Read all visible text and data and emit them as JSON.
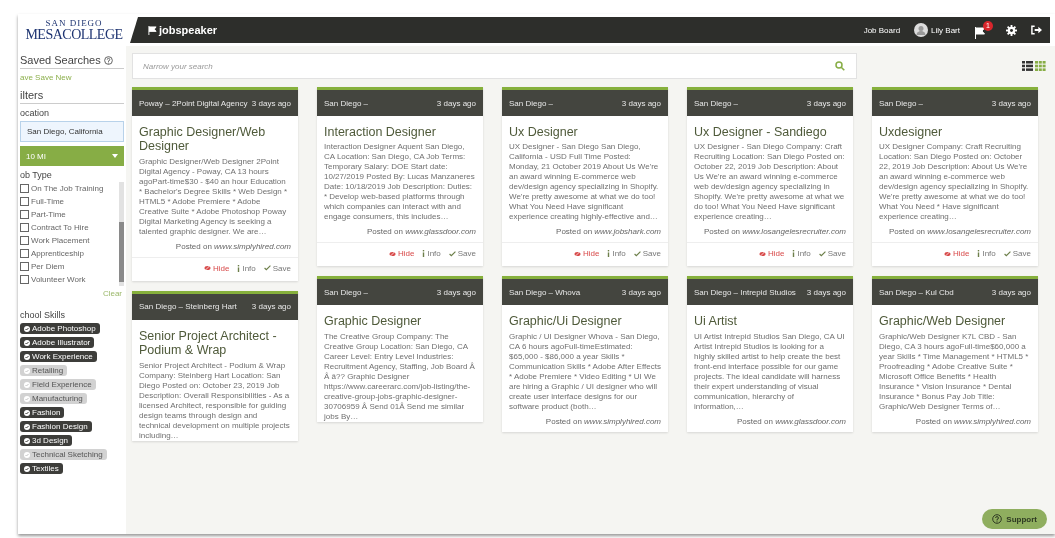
{
  "logo": {
    "line1": "SAN DIEGO",
    "line2": "MESACOLLEGE"
  },
  "header": {
    "brand": "jobspeaker",
    "nav": "Job Board",
    "user": "Lily Bart",
    "notification_count": "1"
  },
  "sidebar": {
    "saved_title": "Saved Searches",
    "saved_links": "ave Save New",
    "filters_title": "ilters",
    "location_label": "ocation",
    "location_value": "San Diego, California",
    "distance": "10 MI",
    "job_type_label": "ob Type",
    "job_types": [
      {
        "label": "On The Job Training",
        "checked": false
      },
      {
        "label": "Full-Time",
        "checked": false
      },
      {
        "label": "Part-Time",
        "checked": false
      },
      {
        "label": "Contract To Hire",
        "checked": false
      },
      {
        "label": "Work Placement",
        "checked": false
      },
      {
        "label": "Apprenticeship",
        "checked": false
      },
      {
        "label": "Per Diem",
        "checked": false
      },
      {
        "label": "Volunteer Work",
        "checked": false
      }
    ],
    "clear": "Clear",
    "skills_label": "chool Skills",
    "skills": [
      {
        "label": "Adobe Photoshop",
        "selected": true
      },
      {
        "label": "Adobe Illustrator",
        "selected": true
      },
      {
        "label": "Work Experience",
        "selected": true
      },
      {
        "label": "Retailing",
        "selected": false
      },
      {
        "label": "Field Experience",
        "selected": false
      },
      {
        "label": "Manufacturing",
        "selected": false
      },
      {
        "label": "Fashion",
        "selected": true
      },
      {
        "label": "Fashion Design",
        "selected": true
      },
      {
        "label": "3d Design",
        "selected": true
      },
      {
        "label": "Technical Sketching",
        "selected": false
      },
      {
        "label": "Textiles",
        "selected": true
      }
    ]
  },
  "search": {
    "placeholder": "Narrow your search"
  },
  "view_toggle": [
    {
      "kind": "list",
      "selected": false
    },
    {
      "kind": "grid",
      "selected": true
    }
  ],
  "columns": [
    [
      {
        "location": "Poway – 2Point Digital Agency",
        "age": "3 days ago",
        "title": "Graphic Designer/Web Designer",
        "description": "Graphic Designer/Web Designer 2Point Digital Agency - Poway, CA 13 hours agoPart-time$30 - $40 an hour Education * Bachelor's Degree Skills * Web Design * HTML5 * Adobe Premiere * Adobe Creative Suite * Adobe Photoshop Poway Digital Marketing Agency is seeking a talented graphic designer. We are…",
        "posted": "Posted on *www.simplyhired.com*",
        "actions": [
          {
            "kind": "hide",
            "label": "Hide"
          },
          {
            "kind": "info",
            "label": "Info"
          },
          {
            "kind": "save",
            "label": "Save"
          }
        ]
      },
      {
        "location": "San Diego – Steinberg Hart",
        "age": "3 days ago",
        "title": "Senior Project Architect - Podium & Wrap",
        "description": "Senior Project Architect - Podium & Wrap Company: Steinberg Hart Location: San Diego Posted on: October 23, 2019 Job Description: Overall Responsibilities - As a licensed Architect, responsible for guiding design teams through design and technical development on multiple projects including…"
      }
    ],
    [
      {
        "location": "San Diego –",
        "age": "3 days ago",
        "title": "Interaction Designer",
        "description": "Interaction Designer Aquent San Diego, CA Location: San Diego, CA Job Terms: Temporary Salary: DOE Start date: 10/27/2019 Posted By: Lucas Manzaneres Date: 10/18/2019 Job Description: Duties: * Develop web-based platforms through which companies can interact with and engage consumers, this includes…",
        "posted": "Posted on *www.glassdoor.com*",
        "actions": [
          {
            "kind": "hide",
            "label": "Hide"
          },
          {
            "kind": "info",
            "label": "Info"
          },
          {
            "kind": "save",
            "label": "Save"
          }
        ]
      },
      {
        "location": "San Diego –",
        "age": "3 days ago",
        "title": "Graphic Designer",
        "description": "The Creative Group Company: The Creative Group Location: San Diego, CA Career Level: Entry Level Industries: Recruitment Agency, Staffing, Job Board Â Â â?? Graphic Designer https://www.careerarc.com/job-listing/the-creative-group-jobs-graphic-designer-30706959 Â Send 01Â Send me similar jobs By…"
      }
    ],
    [
      {
        "location": "San Diego –",
        "age": "3 days ago",
        "title": "Ux Designer",
        "description": "UX Designer - San Diego San Diego, California - USD Full Time Posted: Monday, 21 October 2019 About Us We're an award winning E-commerce web dev/design agency specializing in Shopify. We're pretty awesome at what we do too! What You Need Have significant experience creating highly-effective and…",
        "posted": "Posted on *www.jobshark.com*",
        "actions": [
          {
            "kind": "hide",
            "label": "Hide"
          },
          {
            "kind": "info",
            "label": "Info"
          },
          {
            "kind": "save",
            "label": "Save"
          }
        ]
      },
      {
        "location": "San Diego – Whova",
        "age": "3 days ago",
        "title": "Graphic/Ui Designer",
        "description": "Graphic / UI Designer Whova - San Diego, CA 6 hours agoFull-timeEstimated: $65,000 - $86,000 a year Skills * Communication Skills * Adobe After Effects * Adobe Premiere * Video Editing * UI We are hiring a Graphic / UI designer who will create user interface designs for our software product (both…",
        "posted": "Posted on *www.simplyhired.com*"
      }
    ],
    [
      {
        "location": "San Diego –",
        "age": "3 days ago",
        "title": "Ux Designer - Sandiego",
        "description": "UX Designer - San Diego Company: Craft Recruiting Location: San Diego Posted on: October 22, 2019 Job Description: About Us We're an award winning e-commerce web dev/design agency specializing in Shopify. We're pretty awesome at what we do too! What You Need Have significant experience creating…",
        "posted": "Posted on *www.losangelesrecruiter.com*",
        "actions": [
          {
            "kind": "hide",
            "label": "Hide"
          },
          {
            "kind": "info",
            "label": "Info"
          },
          {
            "kind": "save",
            "label": "Save"
          }
        ]
      },
      {
        "location": "San Diego – Intrepid Studios",
        "age": "3 days ago",
        "title": "Ui Artist",
        "description": "UI Artist Intrepid Studios San Diego, CA UI Artist Intrepid Studios is looking for a highly skilled artist to help create the best front-end interface possible for our game projects. The ideal candidate will harness their expert understanding of visual communication, hierarchy of information,…",
        "posted": "Posted on *www.glassdoor.com*"
      }
    ],
    [
      {
        "location": "San Diego –",
        "age": "3 days ago",
        "title": "Uxdesigner",
        "description": "UX Designer Company: Craft Recruiting Location: San Diego Posted on: October 22, 2019 Job Description: About Us We're an award winning e-commerce web dev/design agency specializing in Shopify. We're pretty awesome at what we do too! What You Need * Have significant experience creating…",
        "posted": "Posted on *www.losangelesrecruiter.com*",
        "actions": [
          {
            "kind": "hide",
            "label": "Hide"
          },
          {
            "kind": "info",
            "label": "Info"
          },
          {
            "kind": "save",
            "label": "Save"
          }
        ]
      },
      {
        "location": "San Diego – Kul Cbd",
        "age": "3 days ago",
        "title": "Graphic/Web Designer",
        "description": "Graphic/Web Designer K7L CBD - San Diego, CA 3 hours agoFull-time$60,000 a year Skills * Time Management * HTML5 * Proofreading * Adobe Creative Suite * Microsoft Office Benefits * Health Insurance * Vision Insurance * Dental Insurance * Bonus Pay Job Title: Graphic/Web Designer Terms of…",
        "posted": "Posted on *www.simplyhired.com*"
      }
    ]
  ],
  "support": "Support"
}
